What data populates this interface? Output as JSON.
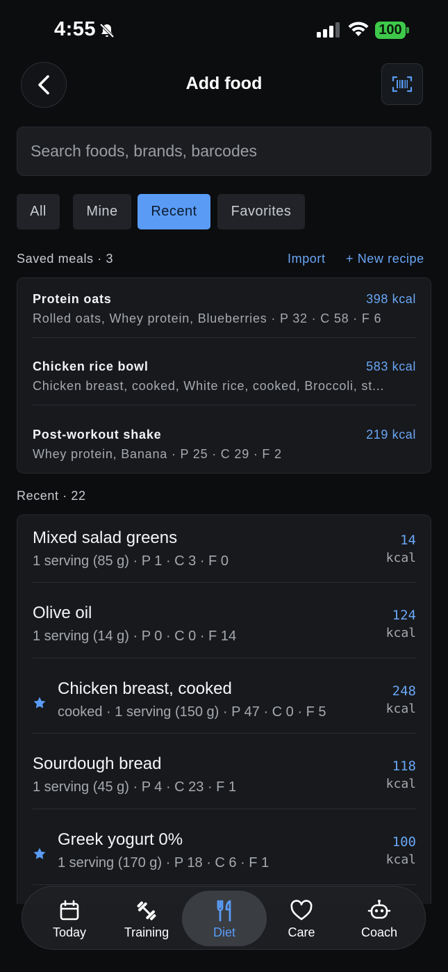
{
  "status": {
    "time": "4:55",
    "battery": "100"
  },
  "header": {
    "title": "Add food"
  },
  "search": {
    "placeholder": "Search foods, brands, barcodes"
  },
  "filters": [
    {
      "label": "All",
      "active": false
    },
    {
      "label": "Mine",
      "active": false
    },
    {
      "label": "Recent",
      "active": true
    },
    {
      "label": "Favorites",
      "active": false
    }
  ],
  "saved_meals": {
    "label": "Saved meals · 3",
    "import_label": "Import",
    "new_recipe_label": "+ New recipe",
    "items": [
      {
        "name": "Protein oats",
        "kcal": "398 kcal",
        "desc": "Rolled oats, Whey protein, Blueberries · P 32 · C 58 · F 6"
      },
      {
        "name": "Chicken rice bowl",
        "kcal": "583 kcal",
        "desc": "Chicken breast, cooked, White rice, cooked, Broccoli, st..."
      },
      {
        "name": "Post-workout shake",
        "kcal": "219 kcal",
        "desc": "Whey protein, Banana · P 25 · C 29 · F 2"
      }
    ]
  },
  "recent": {
    "label": "Recent · 22",
    "items": [
      {
        "name": "Mixed salad greens",
        "desc": "1 serving (85 g) · P 1 · C 3 · F 0",
        "kcal": "14",
        "unit": "kcal",
        "favorite": false
      },
      {
        "name": "Olive oil",
        "desc": "1 serving (14 g) · P 0 · C 0 · F 14",
        "kcal": "124",
        "unit": "kcal",
        "favorite": false
      },
      {
        "name": "Chicken breast, cooked",
        "desc": "cooked · 1 serving (150 g) · P 47 · C 0 · F 5",
        "kcal": "248",
        "unit": "kcal",
        "favorite": true
      },
      {
        "name": "Sourdough bread",
        "desc": "1 serving (45 g) · P 4 · C 23 · F 1",
        "kcal": "118",
        "unit": "kcal",
        "favorite": false
      },
      {
        "name": "Greek yogurt 0%",
        "desc": "1 serving (170 g) · P 18 · C 6 · F 1",
        "kcal": "100",
        "unit": "kcal",
        "favorite": true
      }
    ]
  },
  "tabbar": [
    {
      "label": "Today",
      "icon": "calendar-icon"
    },
    {
      "label": "Training",
      "icon": "dumbbell-icon"
    },
    {
      "label": "Diet",
      "icon": "fork-knife-icon",
      "active": true
    },
    {
      "label": "Care",
      "icon": "heart-icon"
    },
    {
      "label": "Coach",
      "icon": "robot-icon"
    }
  ],
  "colors": {
    "accent": "#5a9cf5",
    "battery": "#3ec94a",
    "background": "#0c0d0f"
  }
}
